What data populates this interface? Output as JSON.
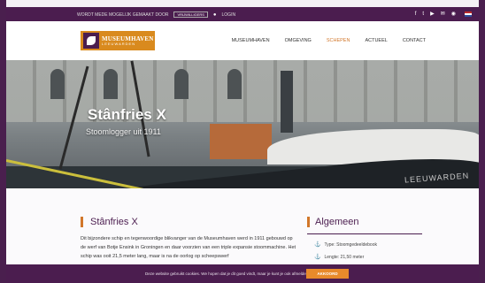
{
  "topbar": {
    "sponsor_text": "WORDT MEDE MOGELIJK GEMAAKT DOOR",
    "sponsor_logo_text": "VRIJWILLIGERS",
    "login_label": "LOGIN",
    "social_icons": [
      "facebook-icon",
      "twitter-icon",
      "youtube-icon",
      "email-icon",
      "rss-icon"
    ]
  },
  "header": {
    "logo_line1": "MUSEUMHAVEN",
    "logo_line2": "LEEUWARDEN",
    "nav": [
      "MUSEUMHAVEN",
      "OMGEVING",
      "SCHEPEN",
      "ACTUEEL",
      "CONTACT"
    ]
  },
  "hero": {
    "title": "Stânfries X",
    "subtitle": "Stoomlogger uit 1911",
    "hull_text": "LEEUWARDEN"
  },
  "content": {
    "heading": "Stânfries X",
    "paragraph": "Dit bijzondere schip en tegenwoordige blikvanger van de Museumhaven werd in 1911 gebouwd op de werf van Botje Ensink in Groningen en daar voorzien van een triple expansie stoommachine. Het schip was ooit 21,5 meter lang, maar is na de oorlog op scheepswerf",
    "sidebar_heading": "Algemeen",
    "info": [
      {
        "label": "Type: Stoomgedeeldebook"
      },
      {
        "label": "Lengte: 21,50 meter"
      }
    ]
  },
  "cookie": {
    "text": "Deze website gebruikt cookies. We hopen dat je dit goed vindt, maar je kunt je ook afmelden als je wilt.",
    "link": "Lees verder",
    "button": "AKKOORD"
  },
  "colors": {
    "brand_purple": "#4b1d4f",
    "accent_orange": "#d2772a"
  }
}
